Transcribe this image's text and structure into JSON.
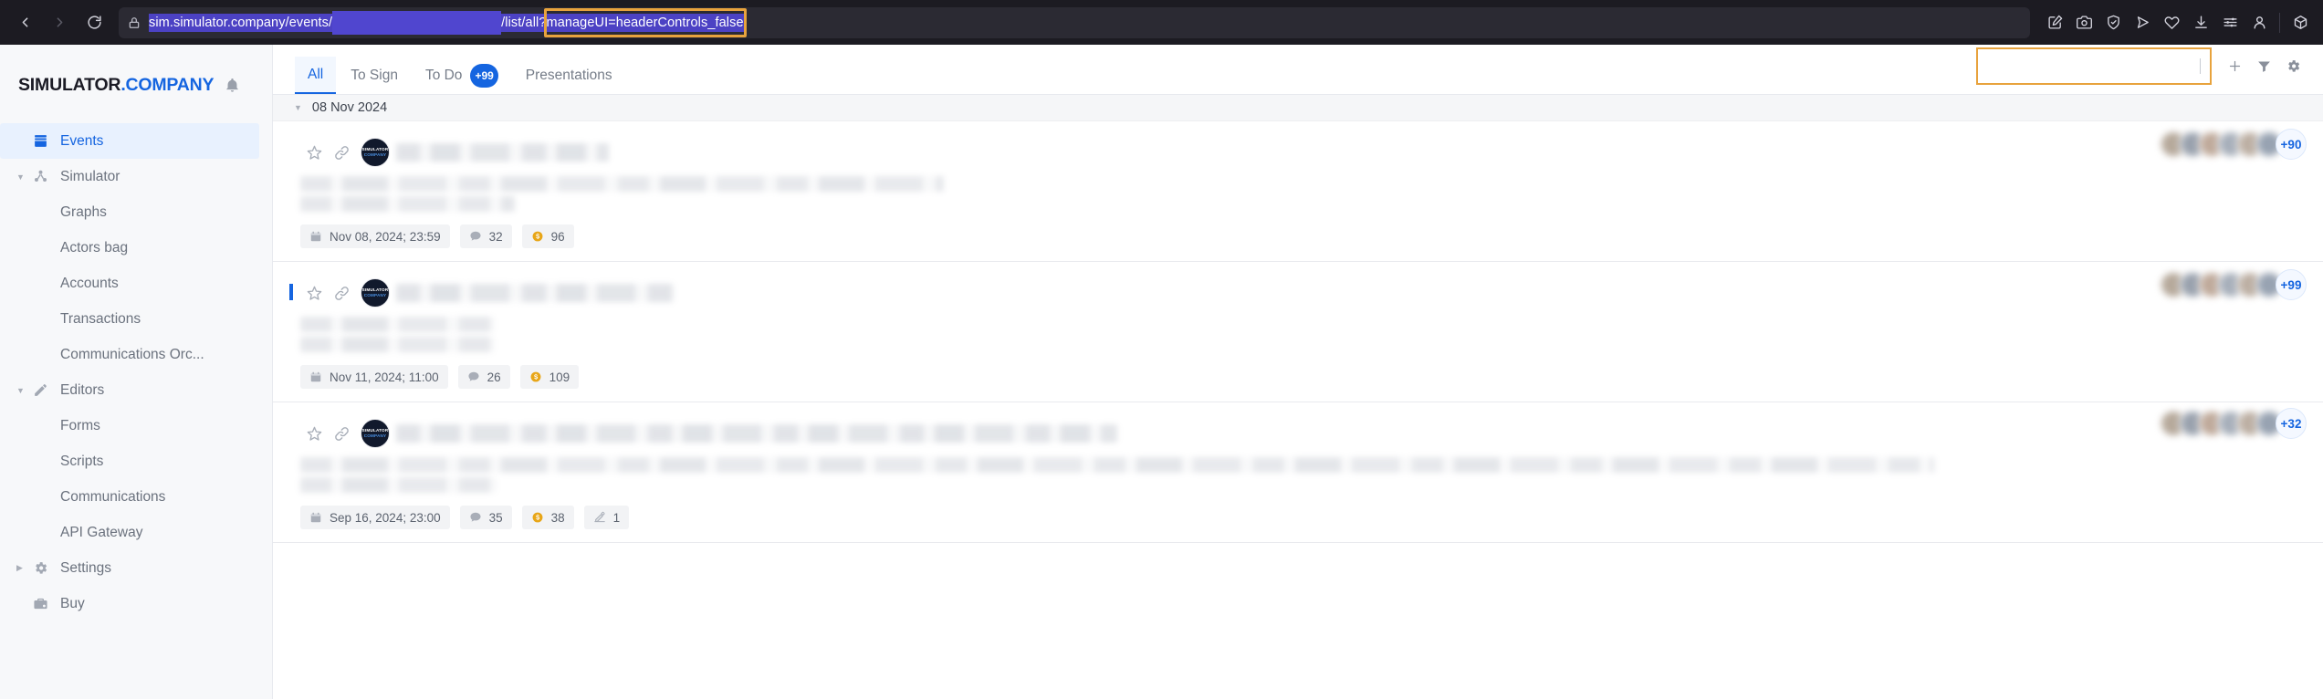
{
  "browser": {
    "nav": {
      "back": "back-arrow",
      "forward": "forward-arrow",
      "reload": "reload"
    },
    "url": {
      "prefix": "sim.simulator.company/events/",
      "middle": "",
      "path": "/list/all?",
      "query": "manageUI=headerControls_false",
      "lock": "lock-icon"
    },
    "toolbar_icons": [
      "edit-annotate-icon",
      "camera-icon",
      "shield-icon",
      "send-icon",
      "heart-icon",
      "download-icon",
      "sliders-icon",
      "account-icon",
      "extension-cube-icon"
    ]
  },
  "sidebar": {
    "brand": {
      "part1": "SIMULATOR",
      "part2": ".COMPANY",
      "bell": "bell-icon"
    },
    "items": [
      {
        "label": "Events",
        "icon": "inbox-icon",
        "level": 0,
        "active": true,
        "caret": ""
      },
      {
        "label": "Simulator",
        "icon": "network-icon",
        "level": 0,
        "active": false,
        "caret": "▼"
      },
      {
        "label": "Graphs",
        "icon": "",
        "level": 1,
        "active": false,
        "caret": ""
      },
      {
        "label": "Actors bag",
        "icon": "",
        "level": 1,
        "active": false,
        "caret": ""
      },
      {
        "label": "Accounts",
        "icon": "",
        "level": 1,
        "active": false,
        "caret": ""
      },
      {
        "label": "Transactions",
        "icon": "",
        "level": 1,
        "active": false,
        "caret": ""
      },
      {
        "label": "Communications Orc...",
        "icon": "",
        "level": 1,
        "active": false,
        "caret": ""
      },
      {
        "label": "Editors",
        "icon": "pencil-icon",
        "level": 0,
        "active": false,
        "caret": "▼"
      },
      {
        "label": "Forms",
        "icon": "",
        "level": 1,
        "active": false,
        "caret": ""
      },
      {
        "label": "Scripts",
        "icon": "",
        "level": 1,
        "active": false,
        "caret": ""
      },
      {
        "label": "Communications",
        "icon": "",
        "level": 1,
        "active": false,
        "caret": ""
      },
      {
        "label": "API Gateway",
        "icon": "",
        "level": 1,
        "active": false,
        "caret": ""
      },
      {
        "label": "Settings",
        "icon": "gear-icon",
        "level": 0,
        "active": false,
        "caret": "▶"
      },
      {
        "label": "Buy",
        "icon": "briefcase-icon",
        "level": 0,
        "active": false,
        "caret": ""
      }
    ]
  },
  "topbar": {
    "tabs": [
      {
        "label": "All",
        "badge": "",
        "active": true
      },
      {
        "label": "To Sign",
        "badge": "",
        "active": false
      },
      {
        "label": "To Do",
        "badge": "+99",
        "active": false
      },
      {
        "label": "Presentations",
        "badge": "",
        "active": false
      }
    ],
    "search": {
      "value": "",
      "placeholder": ""
    },
    "actions": [
      "add-icon",
      "filter-icon",
      "settings-gear-icon"
    ]
  },
  "list": {
    "groups": [
      {
        "date_label": "08 Nov 2024",
        "caret": "▼",
        "rows": [
          {
            "unread": false,
            "avatar": {
              "line1": "SIMULATOR",
              "line2": "COMPANY"
            },
            "body_lines": 2,
            "chips": [
              {
                "icon": "calendar-icon",
                "text": "Nov 08, 2024; 23:59",
                "type": "date"
              },
              {
                "icon": "comment-icon",
                "text": "32",
                "type": "comments"
              },
              {
                "icon": "coin-icon",
                "text": "96",
                "type": "coins"
              }
            ],
            "participants_more": "+90"
          },
          {
            "unread": true,
            "avatar": {
              "line1": "SIMULATOR",
              "line2": "COMPANY"
            },
            "body_lines": 2,
            "chips": [
              {
                "icon": "calendar-icon",
                "text": "Nov 11, 2024; 11:00",
                "type": "date"
              },
              {
                "icon": "comment-icon",
                "text": "26",
                "type": "comments"
              },
              {
                "icon": "coin-icon",
                "text": "109",
                "type": "coins"
              }
            ],
            "participants_more": "+99"
          },
          {
            "unread": false,
            "avatar": {
              "line1": "SIMULATOR",
              "line2": "COMPANY"
            },
            "body_lines": 2,
            "chips": [
              {
                "icon": "calendar-icon",
                "text": "Sep 16, 2024; 23:00",
                "type": "date"
              },
              {
                "icon": "comment-icon",
                "text": "35",
                "type": "comments"
              },
              {
                "icon": "coin-icon",
                "text": "38",
                "type": "coins"
              },
              {
                "icon": "signature-icon",
                "text": "1",
                "type": "signature"
              }
            ],
            "participants_more": "+32"
          }
        ]
      }
    ]
  },
  "colors": {
    "accent_blue": "#1565e0",
    "highlight_orange": "#e8a33d",
    "coin_gold": "#e8a618",
    "chrome_bg": "#1c1b22",
    "url_select": "#4c42c4"
  }
}
